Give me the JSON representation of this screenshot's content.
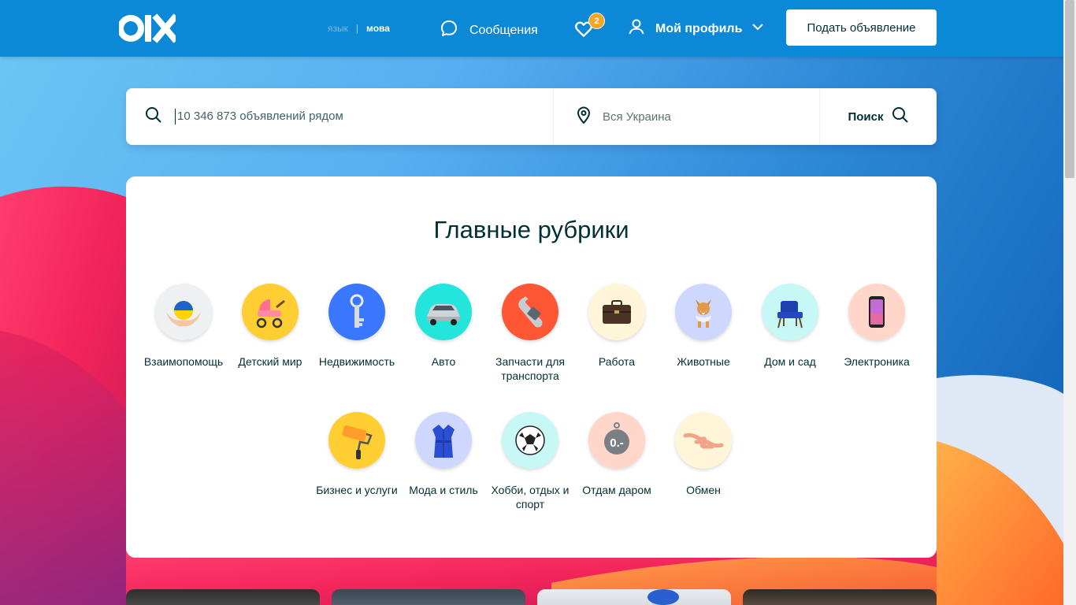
{
  "header": {
    "logo_text": "olx",
    "lang_ru": "язык",
    "lang_separator": "|",
    "lang_ua": "мова",
    "messages_label": "Сообщения",
    "favorites_count": "2",
    "profile_label": "Мой профиль",
    "post_ad_label": "Подать объявление"
  },
  "search": {
    "query_placeholder": "10 346 873 объявлений рядом",
    "location_placeholder": "Вся Украина",
    "button_label": "Поиск"
  },
  "categories": {
    "title": "Главные рубрики",
    "items": [
      {
        "label": "Взаимопомощь",
        "icon": "helping-hands-icon",
        "bg": "#eef0f1"
      },
      {
        "label": "Детский мир",
        "icon": "stroller-icon",
        "bg": "#ffce32"
      },
      {
        "label": "Недвижимость",
        "icon": "key-icon",
        "bg": "#3a77ff"
      },
      {
        "label": "Авто",
        "icon": "car-icon",
        "bg": "#23e5db"
      },
      {
        "label": "Запчасти для транспорта",
        "icon": "wrench-icon",
        "bg": "#ff5636"
      },
      {
        "label": "Работа",
        "icon": "briefcase-icon",
        "bg": "#fff6d9"
      },
      {
        "label": "Животные",
        "icon": "dog-icon",
        "bg": "#ced8ff"
      },
      {
        "label": "Дом и сад",
        "icon": "armchair-icon",
        "bg": "#c8f8f6"
      },
      {
        "label": "Электроника",
        "icon": "smartphone-icon",
        "bg": "#ffd6c9"
      },
      {
        "label": "Бизнес и услуги",
        "icon": "paint-roller-icon",
        "bg": "#ffce32"
      },
      {
        "label": "Мода и стиль",
        "icon": "dress-icon",
        "bg": "#ced8ff"
      },
      {
        "label": "Хобби, отдых и спорт",
        "icon": "soccer-ball-icon",
        "bg": "#c8f8f6"
      },
      {
        "label": "Отдам даром",
        "icon": "free-tag-icon",
        "bg": "#ffd6c9"
      },
      {
        "label": "Обмен",
        "icon": "exchange-hands-icon",
        "bg": "#fff6d9"
      }
    ]
  },
  "colors": {
    "header_bg": "#0b89d6",
    "text_dark": "#002f34",
    "badge": "#f5a623"
  }
}
